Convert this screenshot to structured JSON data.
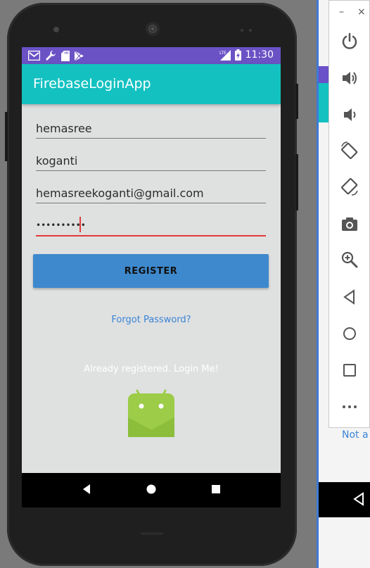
{
  "status_bar": {
    "time": "11:30",
    "network": "LTE"
  },
  "app_bar": {
    "title": "FirebaseLoginApp"
  },
  "form": {
    "first_name": "hemasree",
    "last_name": "koganti",
    "email": "hemasreekoganti@gmail.com",
    "password": "••••••••••"
  },
  "register_button": "REGISTER",
  "forgot_link": "Forgot Password?",
  "login_link": "Already registered. Login Me!",
  "emulator_toolbar": {
    "minimize": "–",
    "close": "×"
  },
  "background": {
    "partial_text": "Not a"
  },
  "colors": {
    "status_bar": "#6a52c5",
    "app_bar": "#14c1c1",
    "button": "#3e89cd",
    "link": "#3a84d6",
    "focus_line": "#e23a3a"
  },
  "icons": [
    "gmail-icon",
    "wrench-icon",
    "sd-card-icon",
    "play-store-icon",
    "lte-signal-icon",
    "battery-charging-icon",
    "power-icon",
    "volume-up-icon",
    "volume-down-icon",
    "rotate-left-icon",
    "rotate-right-icon",
    "camera-icon",
    "zoom-icon",
    "back-icon",
    "home-icon",
    "overview-icon",
    "more-icon",
    "android-logo-icon"
  ]
}
